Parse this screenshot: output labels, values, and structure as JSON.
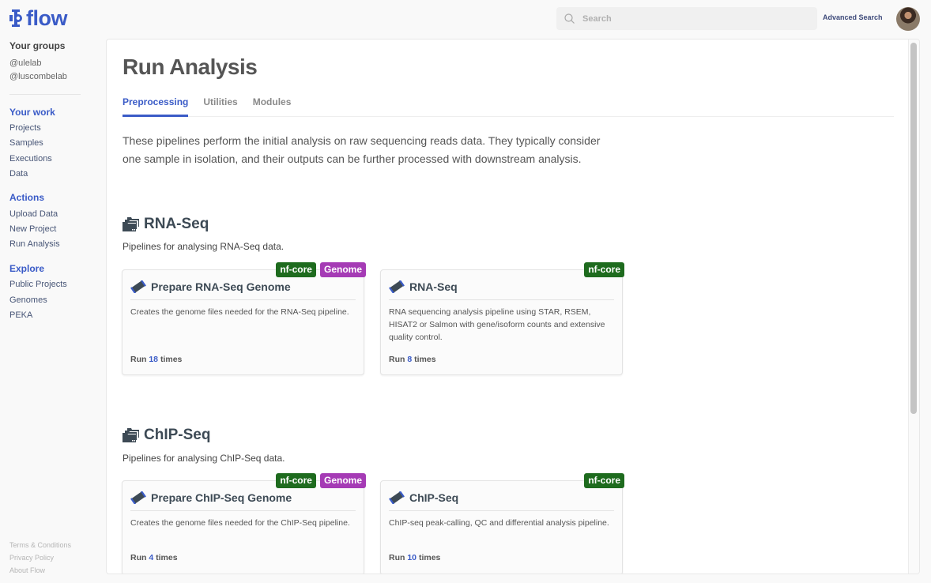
{
  "app": {
    "logo_text": "flow",
    "brand_color": "#3a5bc7"
  },
  "header": {
    "search_placeholder": "Search",
    "search_value": "",
    "advanced_search_label": "Advanced Search"
  },
  "sidebar": {
    "groups_title": "Your groups",
    "groups": [
      "@ulelab",
      "@luscombelab"
    ],
    "sections": [
      {
        "heading": "Your work",
        "items": [
          "Projects",
          "Samples",
          "Executions",
          "Data"
        ]
      },
      {
        "heading": "Actions",
        "items": [
          "Upload Data",
          "New Project",
          "Run Analysis"
        ]
      },
      {
        "heading": "Explore",
        "items": [
          "Public Projects",
          "Genomes",
          "PEKA"
        ]
      }
    ],
    "footer": [
      "Terms & Conditions",
      "Privacy Policy",
      "About Flow"
    ]
  },
  "main": {
    "title": "Run Analysis",
    "tabs": [
      {
        "label": "Preprocessing",
        "active": true
      },
      {
        "label": "Utilities",
        "active": false
      },
      {
        "label": "Modules",
        "active": false
      }
    ],
    "intro": "These pipelines perform the initial analysis on raw sequencing reads data. They typically consider one sample in isolation, and their outputs can be further processed with downstream analysis.",
    "sections": [
      {
        "title": "RNA-Seq",
        "description": "Pipelines for analysing RNA-Seq data.",
        "cards": [
          {
            "title": "Prepare RNA-Seq Genome",
            "description": "Creates the genome files needed for the RNA-Seq pipeline.",
            "run_prefix": "Run",
            "run_count": "18",
            "run_suffix": "times",
            "badges": [
              "nf-core",
              "Genome"
            ]
          },
          {
            "title": "RNA-Seq",
            "description": "RNA sequencing analysis pipeline using STAR, RSEM, HISAT2 or Salmon with gene/isoform counts and extensive quality control.",
            "run_prefix": "Run",
            "run_count": "8",
            "run_suffix": "times",
            "badges": [
              "nf-core"
            ]
          }
        ]
      },
      {
        "title": "ChIP-Seq",
        "description": "Pipelines for analysing ChIP-Seq data.",
        "cards": [
          {
            "title": "Prepare ChIP-Seq Genome",
            "description": "Creates the genome files needed for the ChIP-Seq pipeline.",
            "run_prefix": "Run",
            "run_count": "4",
            "run_suffix": "times",
            "badges": [
              "nf-core",
              "Genome"
            ]
          },
          {
            "title": "ChIP-Seq",
            "description": "ChIP-seq peak-calling, QC and differential analysis pipeline.",
            "run_prefix": "Run",
            "run_count": "10",
            "run_suffix": "times",
            "badges": [
              "nf-core"
            ]
          }
        ]
      }
    ]
  },
  "colors": {
    "nf_core_badge": "#1e6b1e",
    "genome_badge": "#a53bb5",
    "accent": "#3a5bc7"
  }
}
